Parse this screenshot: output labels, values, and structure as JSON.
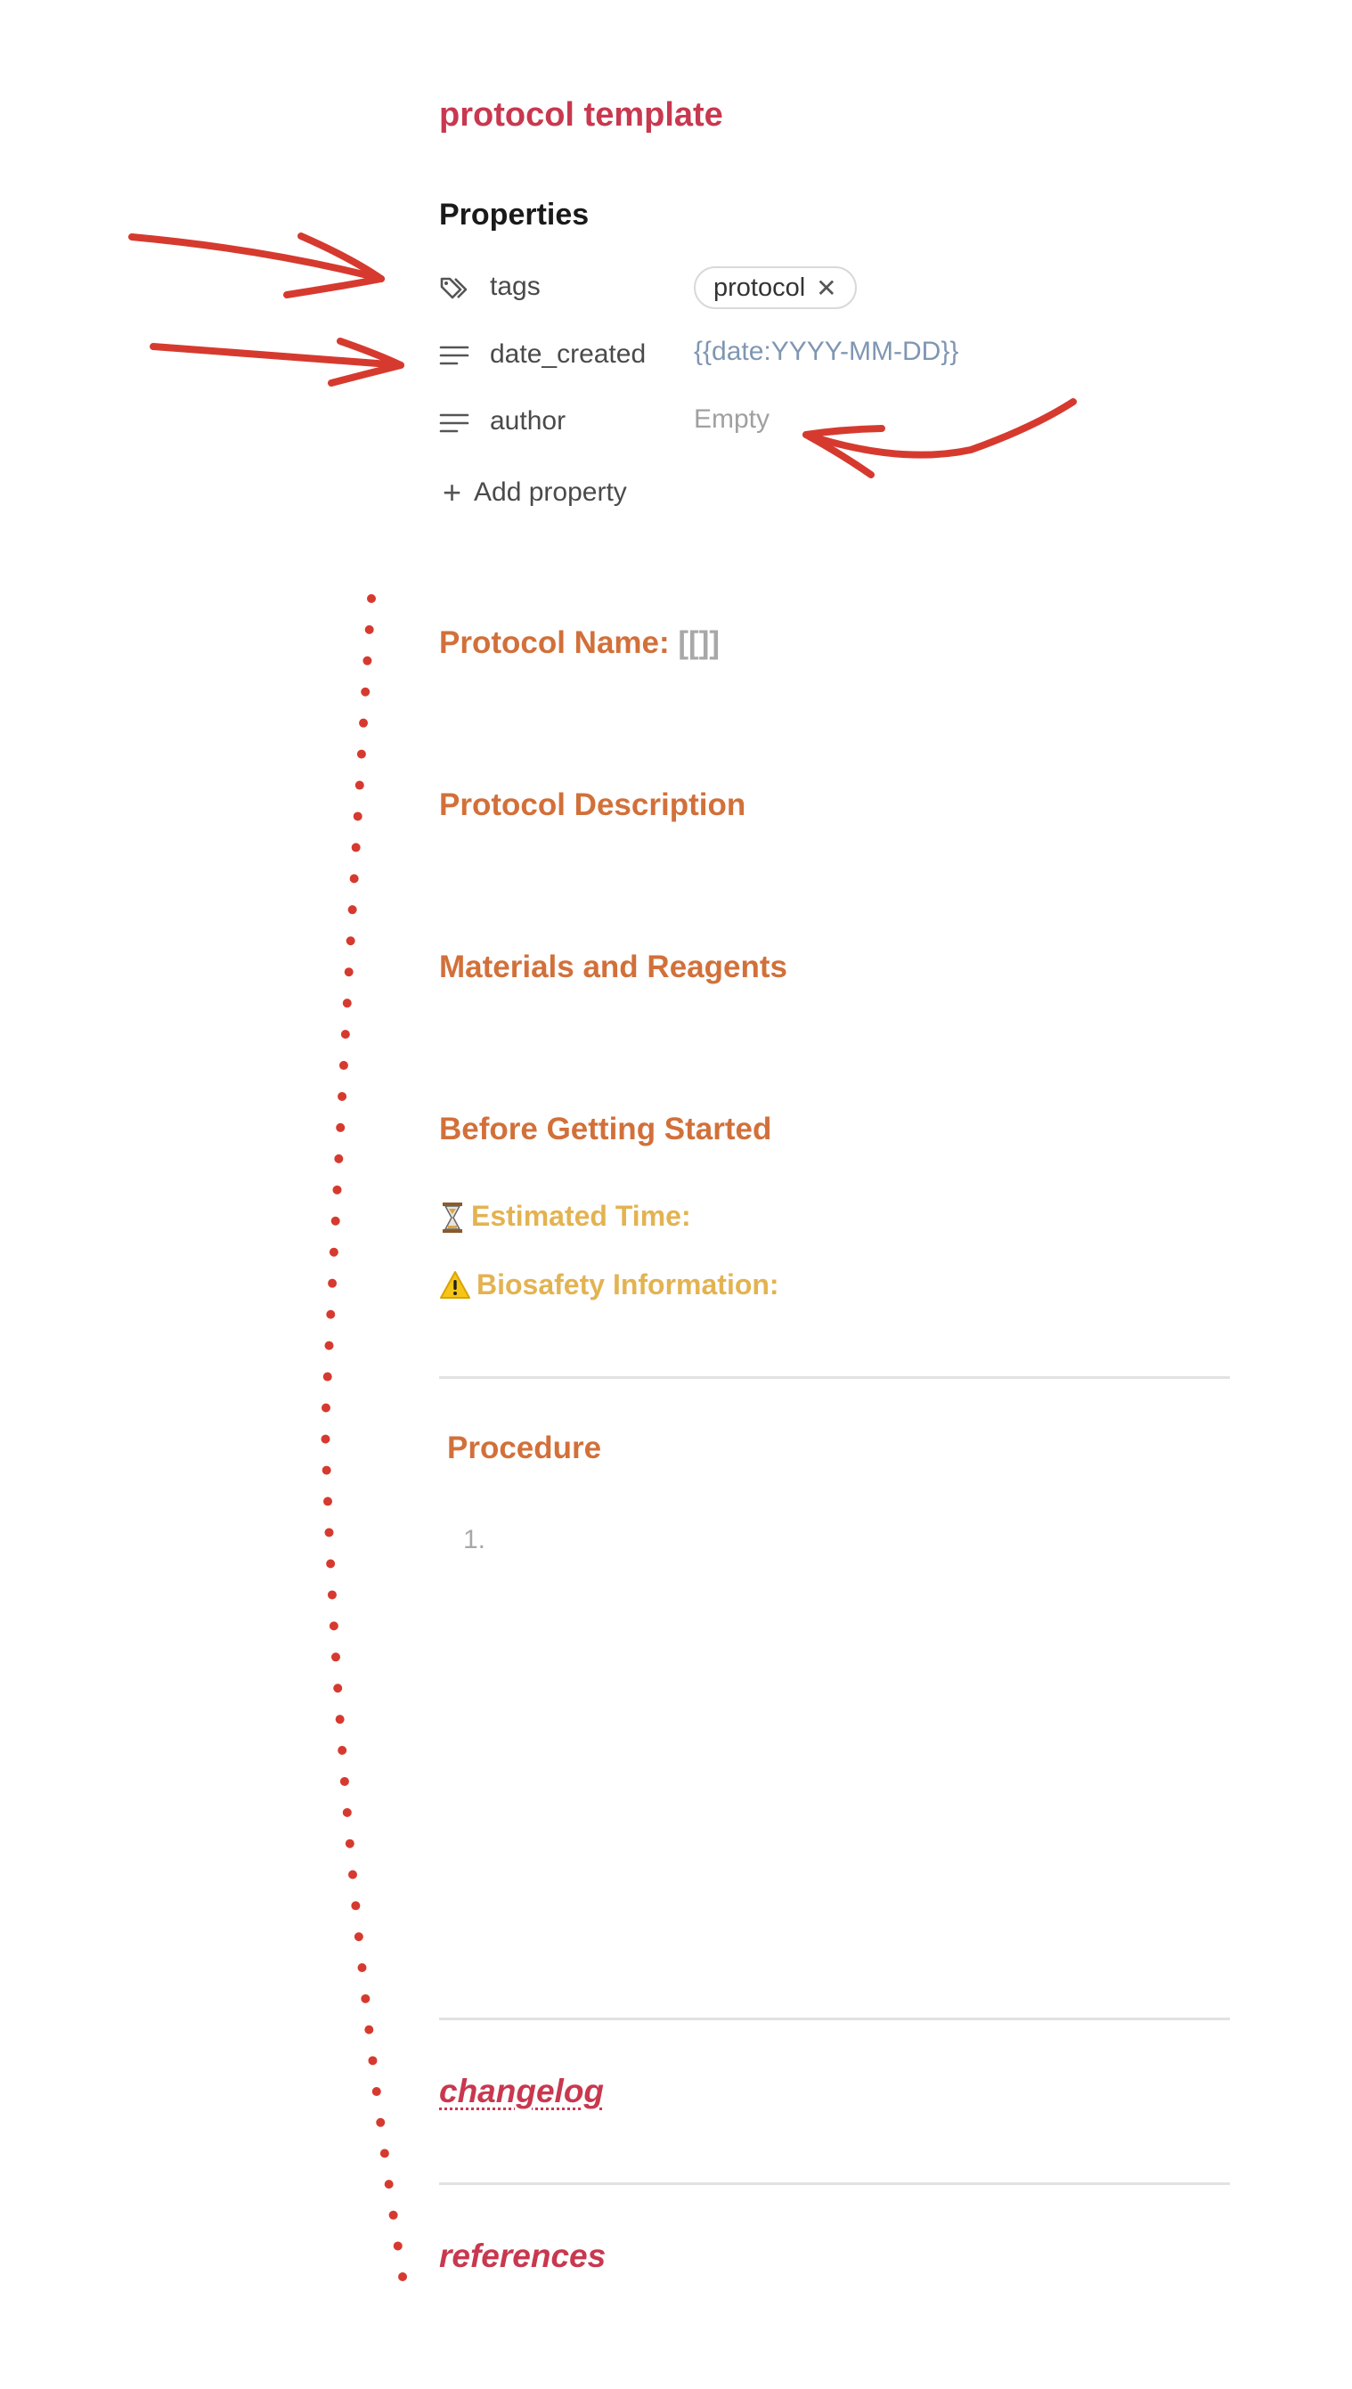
{
  "note": {
    "title": "protocol template"
  },
  "properties": {
    "heading": "Properties",
    "items": [
      {
        "name": "tags",
        "icon": "tag-icon",
        "tag_value": "protocol",
        "remove_glyph": "✕"
      },
      {
        "name": "date_created",
        "icon": "text-lines-icon",
        "value": "{{date:YYYY-MM-DD}}"
      },
      {
        "name": "author",
        "icon": "text-lines-icon",
        "value": "Empty"
      }
    ],
    "add_label": "Add property",
    "add_glyph": "+"
  },
  "sections": {
    "protocol_name_label": "Protocol Name:",
    "protocol_name_placeholder": "[[]]",
    "protocol_description": "Protocol Description",
    "materials": "Materials and Reagents",
    "before_started": "Before Getting Started",
    "estimated_time": "Estimated Time:",
    "biosafety": "Biosafety Information:",
    "procedure": "Procedure",
    "procedure_first_item": "1.",
    "changelog": "changelog",
    "references": "references"
  },
  "colors": {
    "title": "#c8384f",
    "heading": "#d2703a",
    "callout": "#e3b352",
    "annotation": "#d63a2f",
    "date_value": "#7f96b3"
  }
}
